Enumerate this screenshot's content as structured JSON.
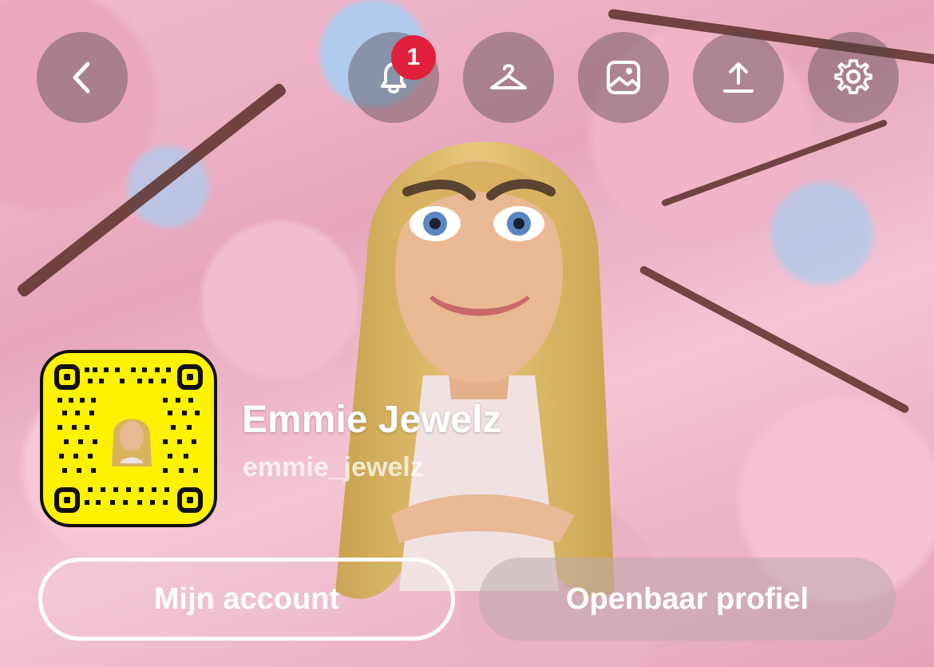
{
  "header": {
    "notification_count": "1",
    "buttons": [
      {
        "icon": "back-icon"
      },
      {
        "icon": "bell-icon"
      },
      {
        "icon": "hanger-icon"
      },
      {
        "icon": "image-icon"
      },
      {
        "icon": "upload-icon"
      },
      {
        "icon": "gear-icon"
      }
    ]
  },
  "profile": {
    "display_name": "Emmie Jewelz",
    "username": "emmie_jewelz"
  },
  "actions": {
    "my_account_label": "Mijn account",
    "public_profile_label": "Openbaar profiel"
  },
  "colors": {
    "snapcode_yellow": "#fff200",
    "badge_red": "#e0203b"
  }
}
